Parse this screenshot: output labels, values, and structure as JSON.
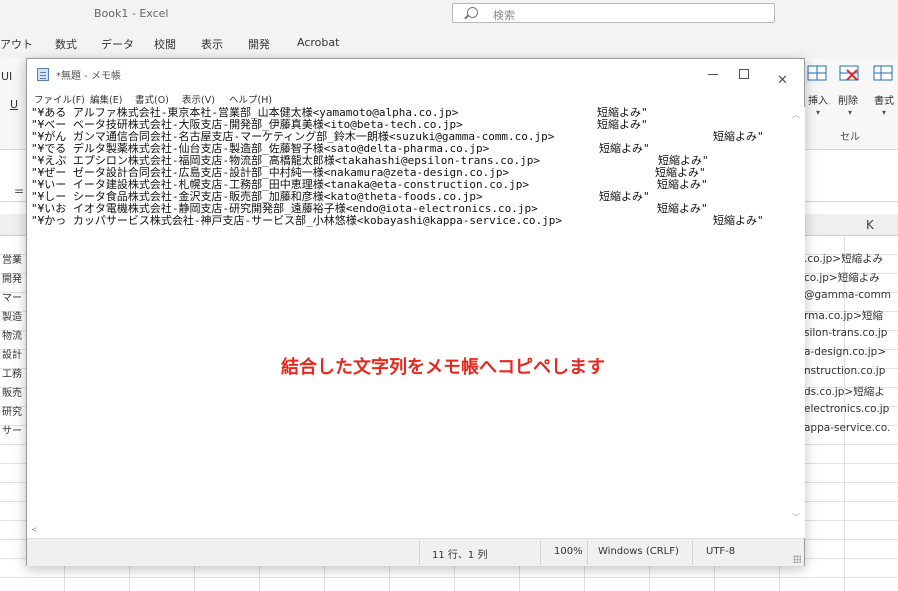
{
  "excel": {
    "title": "Book1  -  Excel",
    "search_placeholder": "検索",
    "menus": [
      "アウト",
      "数式",
      "データ",
      "校閲",
      "表示",
      "開発",
      "Acrobat"
    ],
    "ribbon_left_top": "UI",
    "ribbon_left_mid": "U",
    "ribbon_insert": "挿入",
    "ribbon_delete": "削除",
    "ribbon_format": "書式",
    "cell_group": "セル",
    "formula_eq": "=",
    "column_k": "K",
    "row_labels": [
      "営業",
      "開発",
      "マー",
      "製造",
      "物流",
      "設計",
      "工務",
      "販売",
      "研究",
      "サー"
    ],
    "k_cells": [
      ".co.jp>短縮よみ",
      "co.jp>短縮よみ",
      "@gamma-comm",
      "rma.co.jp>短縮",
      "silon-trans.co.jp",
      "a-design.co.jp>",
      "nstruction.co.jp",
      "ds.co.jp>短縮よ",
      "electronics.co.jp",
      "appa-service.co."
    ]
  },
  "notepad": {
    "title": "*無題 - メモ帳",
    "menus": [
      "ファイル(F)",
      "編集(E)",
      "書式(O)",
      "表示(V)",
      "ヘルプ(H)"
    ],
    "lines": [
      {
        "text": "\"¥ある アルファ株式会社-東京本社-営業部_山本健太様<yamamoto@alpha.co.jp>",
        "suffix": "短縮よみ\""
      },
      {
        "text": "\"¥べー ベータ技研株式会社-大阪支店-開発部_伊藤真美様<ito@beta-tech.co.jp>",
        "suffix": "短縮よみ\""
      },
      {
        "text": "\"¥がん ガンマ通信合同会社-名古屋支店-マーケティング部_鈴木一朗様<suzuki@gamma-comm.co.jp>",
        "suffix": "短縮よみ\""
      },
      {
        "text": "\"¥でる デルタ製薬株式会社-仙台支店-製造部_佐藤智子様<sato@delta-pharma.co.jp>",
        "suffix": "短縮よみ\""
      },
      {
        "text": "\"¥えぷ エプシロン株式会社-福岡支店-物流部_高橋龍太郎様<takahashi@epsilon-trans.co.jp>",
        "suffix": "短縮よみ\""
      },
      {
        "text": "\"¥ぜー ゼータ設計合同会社-広島支店-設計部_中村純一様<nakamura@zeta-design.co.jp>",
        "suffix": "短縮よみ\""
      },
      {
        "text": "\"¥いー イータ建設株式会社-札幌支店-工務部_田中恵理様<tanaka@eta-construction.co.jp>",
        "suffix": "短縮よみ\""
      },
      {
        "text": "\"¥しー シータ食品株式会社-金沢支店-販売部_加藤和彦様<kato@theta-foods.co.jp>",
        "suffix": "短縮よみ\""
      },
      {
        "text": "\"¥いお イオタ電機株式会社-静岡支店-研究開発部_遠藤裕子様<endo@iota-electronics.co.jp>",
        "suffix": "短縮よみ\""
      },
      {
        "text": "\"¥かっ カッパサービス株式会社-神戸支店-サービス部_小林悠様<kobayashi@kappa-service.co.jp>",
        "suffix": "短縮よみ\""
      }
    ],
    "overlay_note": "結合した文字列をメモ帳へコピペします",
    "status": {
      "position": "11 行、1 列",
      "zoom": "100%",
      "line_ending": "Windows (CRLF)",
      "encoding": "UTF-8"
    }
  }
}
